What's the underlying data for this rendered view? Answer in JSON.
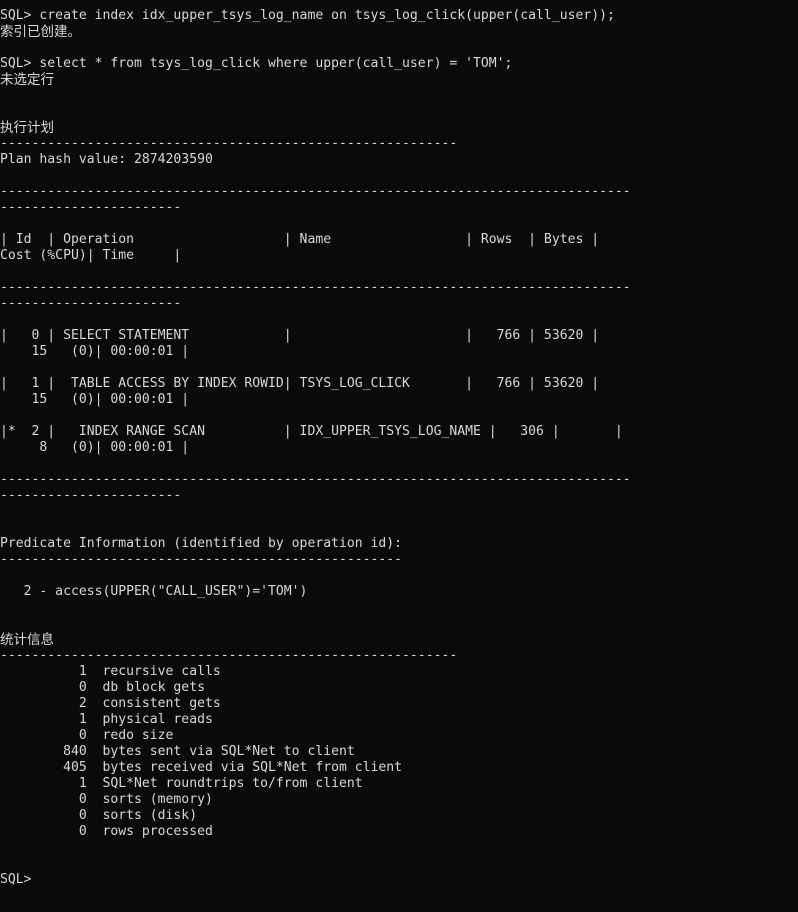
{
  "terminal": {
    "title": "SQL*Plus",
    "prompt": "SQL> ",
    "colors": {
      "background": "#0a0a0a",
      "foreground": "#d8d8d8"
    },
    "lines": [
      {
        "id": "cmd-create-index",
        "text": "SQL> create index idx_upper_tsys_log_name on tsys_log_click(upper(call_user));",
        "kind": "command"
      },
      {
        "id": "msg-index-created",
        "text": "索引已创建。",
        "kind": "message",
        "cjk": true
      },
      {
        "id": "blank-1",
        "text": "",
        "kind": "blank"
      },
      {
        "id": "cmd-select",
        "text": "SQL> select * from tsys_log_click where upper(call_user) = 'TOM';",
        "kind": "command"
      },
      {
        "id": "msg-no-rows",
        "text": "未选定行",
        "kind": "message",
        "cjk": true
      },
      {
        "id": "blank-2",
        "text": "",
        "kind": "blank"
      },
      {
        "id": "blank-3",
        "text": "",
        "kind": "blank"
      },
      {
        "id": "heading-exec-plan",
        "text": "执行计划",
        "kind": "heading",
        "cjk": true
      },
      {
        "id": "sep-exec-plan",
        "text": "----------------------------------------------------------",
        "kind": "separator"
      },
      {
        "id": "plan-hash",
        "text": "Plan hash value: 2874203590",
        "kind": "output"
      },
      {
        "id": "blank-4",
        "text": "",
        "kind": "blank"
      },
      {
        "id": "plan-rule-top-1",
        "text": "--------------------------------------------------------------------------------",
        "kind": "separator"
      },
      {
        "id": "plan-rule-top-2",
        "text": "-----------------------",
        "kind": "separator"
      },
      {
        "id": "blank-5",
        "text": "",
        "kind": "blank"
      },
      {
        "id": "plan-header-1",
        "text": "| Id  | Operation                   | Name                 | Rows  | Bytes |",
        "kind": "table-header"
      },
      {
        "id": "plan-header-2",
        "text": "Cost (%CPU)| Time     |",
        "kind": "table-header"
      },
      {
        "id": "blank-6",
        "text": "",
        "kind": "blank"
      },
      {
        "id": "plan-rule-mid-1",
        "text": "--------------------------------------------------------------------------------",
        "kind": "separator"
      },
      {
        "id": "plan-rule-mid-2",
        "text": "-----------------------",
        "kind": "separator"
      },
      {
        "id": "blank-7",
        "text": "",
        "kind": "blank"
      },
      {
        "id": "plan-row-0a",
        "text": "|   0 | SELECT STATEMENT            |                      |   766 | 53620 |",
        "kind": "table-row"
      },
      {
        "id": "plan-row-0b",
        "text": "    15   (0)| 00:00:01 |",
        "kind": "table-row"
      },
      {
        "id": "blank-8",
        "text": "",
        "kind": "blank"
      },
      {
        "id": "plan-row-1a",
        "text": "|   1 |  TABLE ACCESS BY INDEX ROWID| TSYS_LOG_CLICK       |   766 | 53620 |",
        "kind": "table-row"
      },
      {
        "id": "plan-row-1b",
        "text": "    15   (0)| 00:00:01 |",
        "kind": "table-row"
      },
      {
        "id": "blank-9",
        "text": "",
        "kind": "blank"
      },
      {
        "id": "plan-row-2a",
        "text": "|*  2 |   INDEX RANGE SCAN          | IDX_UPPER_TSYS_LOG_NAME |   306 |       |",
        "kind": "table-row"
      },
      {
        "id": "plan-row-2b",
        "text": "     8   (0)| 00:00:01 |",
        "kind": "table-row"
      },
      {
        "id": "blank-10",
        "text": "",
        "kind": "blank"
      },
      {
        "id": "plan-rule-bot-1",
        "text": "--------------------------------------------------------------------------------",
        "kind": "separator"
      },
      {
        "id": "plan-rule-bot-2",
        "text": "-----------------------",
        "kind": "separator"
      },
      {
        "id": "blank-11",
        "text": "",
        "kind": "blank"
      },
      {
        "id": "blank-12",
        "text": "",
        "kind": "blank"
      },
      {
        "id": "predicate-heading",
        "text": "Predicate Information (identified by operation id):",
        "kind": "output"
      },
      {
        "id": "predicate-sep",
        "text": "---------------------------------------------------",
        "kind": "separator"
      },
      {
        "id": "blank-13",
        "text": "",
        "kind": "blank"
      },
      {
        "id": "predicate-2",
        "text": "   2 - access(UPPER(\"CALL_USER\")='TOM')",
        "kind": "output"
      },
      {
        "id": "blank-14",
        "text": "",
        "kind": "blank"
      },
      {
        "id": "blank-15",
        "text": "",
        "kind": "blank"
      },
      {
        "id": "heading-stats",
        "text": "统计信息",
        "kind": "heading",
        "cjk": true
      },
      {
        "id": "sep-stats",
        "text": "----------------------------------------------------------",
        "kind": "separator"
      },
      {
        "id": "stat-recursive-calls",
        "text": "          1  recursive calls",
        "kind": "output"
      },
      {
        "id": "stat-db-block-gets",
        "text": "          0  db block gets",
        "kind": "output"
      },
      {
        "id": "stat-consistent-gets",
        "text": "          2  consistent gets",
        "kind": "output"
      },
      {
        "id": "stat-physical-reads",
        "text": "          1  physical reads",
        "kind": "output"
      },
      {
        "id": "stat-redo-size",
        "text": "          0  redo size",
        "kind": "output"
      },
      {
        "id": "stat-bytes-sent",
        "text": "        840  bytes sent via SQL*Net to client",
        "kind": "output"
      },
      {
        "id": "stat-bytes-received",
        "text": "        405  bytes received via SQL*Net from client",
        "kind": "output"
      },
      {
        "id": "stat-roundtrips",
        "text": "          1  SQL*Net roundtrips to/from client",
        "kind": "output"
      },
      {
        "id": "stat-sorts-memory",
        "text": "          0  sorts (memory)",
        "kind": "output"
      },
      {
        "id": "stat-sorts-disk",
        "text": "          0  sorts (disk)",
        "kind": "output"
      },
      {
        "id": "stat-rows-processed",
        "text": "          0  rows processed",
        "kind": "output"
      },
      {
        "id": "blank-16",
        "text": "",
        "kind": "blank"
      },
      {
        "id": "blank-17",
        "text": "",
        "kind": "blank"
      },
      {
        "id": "prompt-final",
        "text": "SQL>",
        "kind": "prompt"
      }
    ]
  },
  "session": {
    "statements": [
      "create index idx_upper_tsys_log_name on tsys_log_click(upper(call_user));",
      "select * from tsys_log_click where upper(call_user) = 'TOM';"
    ],
    "plan_hash_value": "2874203590",
    "plan_columns": [
      "Id",
      "Operation",
      "Name",
      "Rows",
      "Bytes",
      "Cost (%CPU)",
      "Time"
    ],
    "plan_rows": [
      {
        "id": "0",
        "operation": "SELECT STATEMENT",
        "name": "",
        "rows": "766",
        "bytes": "53620",
        "cost": "15   (0)",
        "time": "00:00:01"
      },
      {
        "id": "1",
        "operation": "TABLE ACCESS BY INDEX ROWID",
        "name": "TSYS_LOG_CLICK",
        "rows": "766",
        "bytes": "53620",
        "cost": "15   (0)",
        "time": "00:00:01"
      },
      {
        "id": "*  2",
        "operation": "INDEX RANGE SCAN",
        "name": "IDX_UPPER_TSYS_LOG_NAME",
        "rows": "306",
        "bytes": "",
        "cost": "8   (0)",
        "time": "00:00:01"
      }
    ],
    "predicates": [
      {
        "id": "2",
        "type": "access",
        "expression": "access(UPPER(\"CALL_USER\")='TOM')"
      }
    ],
    "statistics": [
      {
        "value": "1",
        "label": "recursive calls"
      },
      {
        "value": "0",
        "label": "db block gets"
      },
      {
        "value": "2",
        "label": "consistent gets"
      },
      {
        "value": "1",
        "label": "physical reads"
      },
      {
        "value": "0",
        "label": "redo size"
      },
      {
        "value": "840",
        "label": "bytes sent via SQL*Net to client"
      },
      {
        "value": "405",
        "label": "bytes received via SQL*Net from client"
      },
      {
        "value": "1",
        "label": "SQL*Net roundtrips to/from client"
      },
      {
        "value": "0",
        "label": "sorts (memory)"
      },
      {
        "value": "0",
        "label": "sorts (disk)"
      },
      {
        "value": "0",
        "label": "rows processed"
      }
    ]
  }
}
